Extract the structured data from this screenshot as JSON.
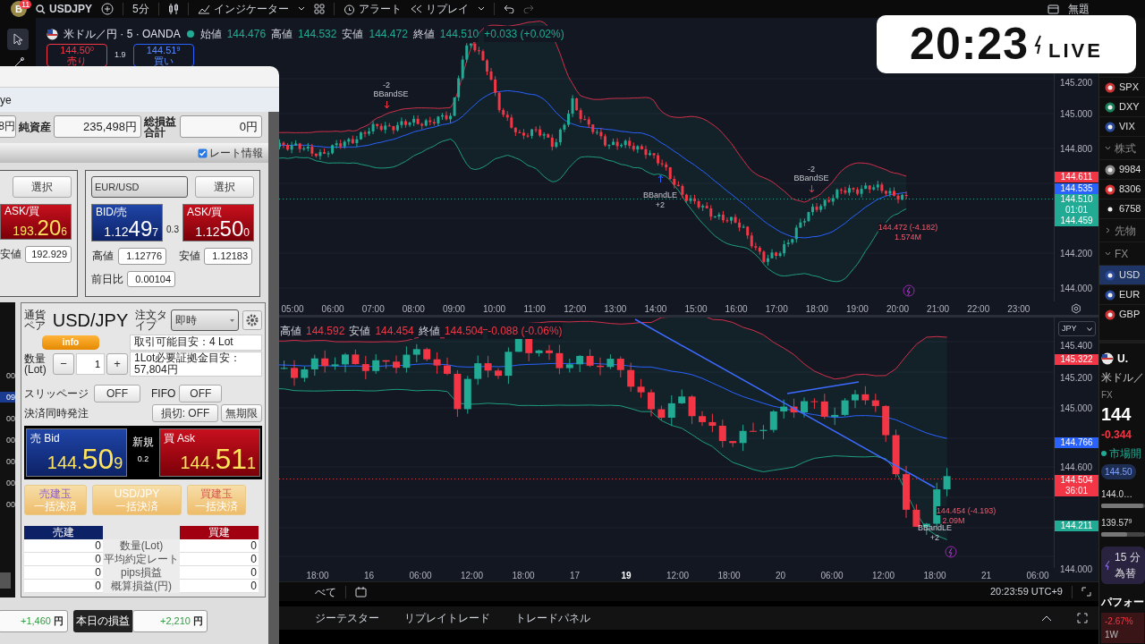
{
  "toolbar": {
    "avatar": "B",
    "avatar_badge": "11",
    "symbol": "USDJPY",
    "interval": "5分",
    "indicators": "インジケーター",
    "alert": "アラート",
    "replay": "リプレイ",
    "layout_name": "無題"
  },
  "live_clock": {
    "time": "20:23",
    "label": "LIVE"
  },
  "main_chart": {
    "title": "米ドル／円 · 5 · OANDA",
    "ohlc": [
      {
        "label": "始値",
        "value": "144.476"
      },
      {
        "label": "高値",
        "value": "144.532"
      },
      {
        "label": "安値",
        "value": "144.472"
      },
      {
        "label": "終値",
        "value": "144.510"
      }
    ],
    "change": "+0.033 (+0.02%)",
    "sell": {
      "price": "144.50",
      "pip": "0",
      "label": "売り"
    },
    "spread": "1.9",
    "buy": {
      "price": "144.51",
      "pip": "9",
      "label": "買い"
    },
    "annotations": [
      {
        "text": "-2",
        "kind": "signal"
      },
      {
        "text": "BBandSE",
        "kind": "signal"
      },
      {
        "text": "BBandLE",
        "kind": "signal"
      },
      {
        "text": "+2",
        "kind": "signal"
      },
      {
        "text": "-2",
        "kind": "signal"
      },
      {
        "text": "BBandSE",
        "kind": "signal"
      },
      {
        "text": "144.472 (-4.182)",
        "kind": "price"
      },
      {
        "text": "1.574M",
        "kind": "price"
      }
    ],
    "price_axis": [
      "145.200",
      "145.000",
      "144.800",
      "144.200",
      "144.000"
    ],
    "price_tags": [
      {
        "value": "144.611",
        "color": "#f23645"
      },
      {
        "value": "144.535",
        "color": "#2962ff"
      },
      {
        "value": "144.510",
        "countdown": "01:01",
        "color": "#22ab94"
      },
      {
        "value": "144.459",
        "color": "#22ab94"
      }
    ],
    "time_axis": [
      "05:00",
      "06:00",
      "07:00",
      "08:00",
      "09:00",
      "10:00",
      "11:00",
      "12:00",
      "13:00",
      "14:00",
      "15:00",
      "16:00",
      "17:00",
      "18:00",
      "19:00",
      "20:00",
      "21:00",
      "22:00",
      "23:00"
    ]
  },
  "lower_chart": {
    "ohlc": [
      {
        "label": "高値",
        "value": "144.592"
      },
      {
        "label": "安値",
        "value": "144.454"
      },
      {
        "label": "終値",
        "value": "144.504"
      }
    ],
    "change": "-0.088 (-0.06%)",
    "currency": "JPY",
    "annotations": [
      {
        "text": "144.454 (-4.193)",
        "kind": "price"
      },
      {
        "text": "2.09M",
        "kind": "price"
      },
      {
        "text": "BBandLE",
        "kind": "signal"
      },
      {
        "text": "+2",
        "kind": "signal"
      }
    ],
    "price_axis": [
      "145.400",
      "145.200",
      "145.000",
      "144.600",
      "144.000"
    ],
    "price_tags": [
      {
        "value": "145.322",
        "color": "#f23645"
      },
      {
        "value": "144.766",
        "color": "#2962ff"
      },
      {
        "value": "144.504",
        "countdown": "36:01",
        "color": "#f23645"
      },
      {
        "value": "144.211",
        "color": "#22ab94"
      }
    ],
    "time_axis": [
      {
        "label": "18:00",
        "emphasized": false
      },
      {
        "label": "16",
        "emphasized": false
      },
      {
        "label": "06:00",
        "emphasized": false
      },
      {
        "label": "12:00",
        "emphasized": false
      },
      {
        "label": "18:00",
        "emphasized": false
      },
      {
        "label": "17",
        "emphasized": false
      },
      {
        "label": "19",
        "emphasized": true
      },
      {
        "label": "12:00",
        "emphasized": false
      },
      {
        "label": "18:00",
        "emphasized": false
      },
      {
        "label": "20",
        "emphasized": false
      },
      {
        "label": "06:00",
        "emphasized": false
      },
      {
        "label": "12:00",
        "emphasized": false
      },
      {
        "label": "18:00",
        "emphasized": false
      },
      {
        "label": "21",
        "emphasized": false
      },
      {
        "label": "06:00",
        "emphasized": false
      }
    ]
  },
  "bottom_bar": {
    "range": "べて",
    "clock": "20:23:59 UTC+9"
  },
  "bottom_tabs": [
    "ジーテスター",
    "リプレイトレード",
    "トレードパネル"
  ],
  "watchlist": {
    "items": [
      {
        "kind": "symbol",
        "label": "SPX",
        "selected": false
      },
      {
        "kind": "symbol",
        "label": "DXY",
        "selected": false
      },
      {
        "kind": "symbol",
        "label": "VIX",
        "selected": false
      },
      {
        "kind": "section",
        "label": "株式",
        "expanded": true
      },
      {
        "kind": "symbol",
        "label": "9984",
        "selected": false
      },
      {
        "kind": "symbol",
        "label": "8306",
        "selected": false
      },
      {
        "kind": "symbol",
        "label": "6758",
        "selected": false
      },
      {
        "kind": "section",
        "label": "先物",
        "expanded": false
      },
      {
        "kind": "section",
        "label": "FX",
        "expanded": true
      },
      {
        "kind": "symbol",
        "label": "USD",
        "selected": true
      },
      {
        "kind": "symbol",
        "label": "EUR",
        "selected": false
      },
      {
        "kind": "symbol",
        "label": "GBP",
        "selected": false
      }
    ],
    "detail": {
      "symbol": "U.",
      "name": "米ドル／",
      "market": "FX",
      "price": "144",
      "change": "-0.344",
      "status": "市場開",
      "bid": "144.50",
      "day_range": {
        "low": "144.0…",
        "level": 0.95
      },
      "week_range": {
        "low": "139.57",
        "pip": "9",
        "level": 0.6
      },
      "promo_line1": "15 分",
      "promo_line2": "為替",
      "performance": "パフォー",
      "perf_value": "-2.67%",
      "perf_period": "1W"
    }
  },
  "trade_window": {
    "title": "ye",
    "balance_tail": "8円",
    "net_assets_label": "純資産",
    "net_assets": "235,498円",
    "total_pl_label": "総損益合計",
    "total_pl": "0円",
    "rate_info": {
      "label": "レート情報",
      "checked": true
    },
    "left_card": {
      "select": "選択",
      "ask": {
        "label": "ASK/買",
        "head": "193.",
        "main": "20",
        "pip": "6"
      },
      "low_label": "安値",
      "low": "192.929"
    },
    "right_card": {
      "pair": "EUR/USD",
      "select": "選択",
      "bid": {
        "label": "BID/売",
        "head": "1.12",
        "main": "49",
        "pip": "7"
      },
      "spread": "0.3",
      "ask": {
        "label": "ASK/買",
        "head": "1.12",
        "main": "50",
        "pip": "0"
      },
      "high_label": "高値",
      "high": "1.12776",
      "low_label": "安値",
      "low": "1.12183",
      "change_label": "前日比",
      "change": "0.00104"
    },
    "side_rates": [
      {
        "text": "00",
        "selected": false
      },
      {
        "text": "09",
        "selected": true
      },
      {
        "text": "00",
        "selected": false
      },
      {
        "text": "00",
        "selected": false
      },
      {
        "text": "00",
        "selected": false
      },
      {
        "text": "00",
        "selected": false
      },
      {
        "text": "00",
        "selected": false
      }
    ],
    "order": {
      "pair_label": "通貨ペア",
      "pair": "USD/JPY",
      "info": "info",
      "type_label": "注文タイプ",
      "type": "即時",
      "available": "取引可能目安：4 Lot",
      "qty_label": "数量(Lot)",
      "qty": "1",
      "minus": "−",
      "plus": "+",
      "margin": "1Lot必要証拠金目安：57,804円",
      "slippage_label": "スリッページ",
      "slippage": "OFF",
      "fifo_label": "FIFO",
      "fifo": "OFF",
      "settle_label": "決済同時発注",
      "stop": "損切: OFF",
      "expiry": "無期限",
      "bid": {
        "label": "売 Bid",
        "head": "144.",
        "main": "50",
        "pip": "9"
      },
      "new_label": "新規",
      "spread": "0.2",
      "ask": {
        "label": "買 Ask",
        "head": "144.",
        "main": "51",
        "pip": "1"
      },
      "close_buttons": [
        {
          "line1": "売建玉",
          "line2": "一括決済",
          "kind": "sell"
        },
        {
          "line1": "USD/JPY",
          "line2": "一括決済",
          "kind": "all"
        },
        {
          "line1": "買建玉",
          "line2": "一括決済",
          "kind": "buy"
        }
      ],
      "positions": {
        "sell_header": "売建",
        "buy_header": "買建",
        "rows": [
          {
            "sell": "0",
            "label": "数量(Lot)",
            "buy": "0"
          },
          {
            "sell": "0",
            "label": "平均約定レート",
            "buy": "0"
          },
          {
            "sell": "0",
            "label": "pips損益",
            "buy": "0"
          },
          {
            "sell": "0",
            "label": "概算損益(円)",
            "buy": "0"
          }
        ]
      }
    },
    "footer": {
      "left_value": "+1,460",
      "left_unit": "円",
      "today_label": "本日の損益",
      "today_value": "+2,210",
      "today_unit": "円"
    }
  }
}
